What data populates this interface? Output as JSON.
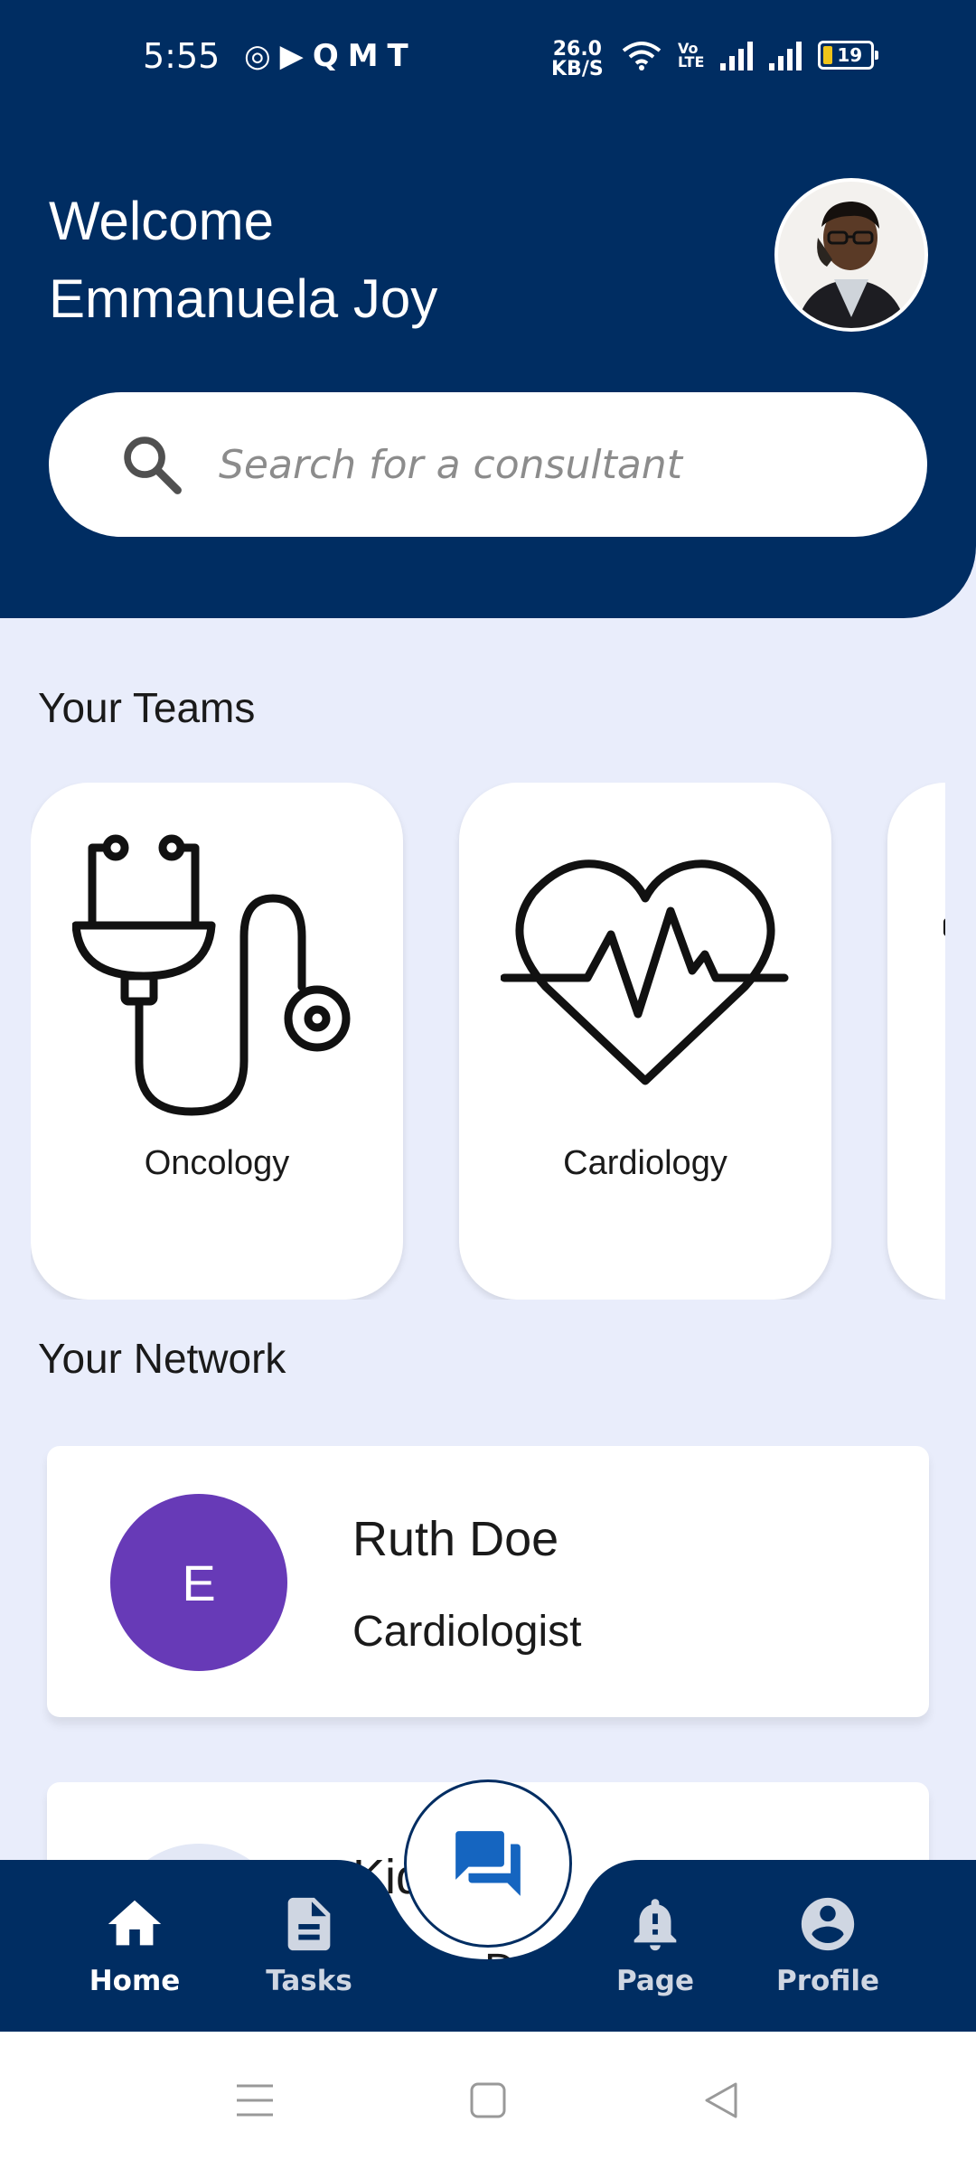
{
  "status_bar": {
    "time": "5:55",
    "app_glyphs": "◎▶QMT",
    "speed_value": "26.0",
    "speed_unit": "KB/S",
    "volte_top": "Vo",
    "volte_bottom": "LTE",
    "battery": "19"
  },
  "header": {
    "greeting": "Welcome",
    "user_name": "Emmanuela Joy",
    "bg_color": "#002d62"
  },
  "search": {
    "placeholder": "Search for a consultant"
  },
  "teams": {
    "title": "Your Teams",
    "items": [
      {
        "label": "Oncology",
        "icon": "stethoscope-icon"
      },
      {
        "label": "Cardiology",
        "icon": "heart-pulse-icon"
      }
    ]
  },
  "network": {
    "title": "Your Network",
    "people": [
      {
        "initial": "E",
        "name": "Ruth Doe",
        "role": "Cardiologist",
        "avatar_color": "#673ab7"
      },
      {
        "initial": "",
        "name": "Kid",
        "role": "Do",
        "avatar_color": "#e3e8f6"
      }
    ]
  },
  "bottom_nav": {
    "items": [
      {
        "label": "Home",
        "icon": "home-icon",
        "active": true
      },
      {
        "label": "Tasks",
        "icon": "document-icon",
        "active": false
      },
      {
        "label": "Page",
        "icon": "bell-icon",
        "active": false
      },
      {
        "label": "Profile",
        "icon": "account-circle-icon",
        "active": false
      }
    ],
    "fab_icon": "chat-icon",
    "accent_color": "#1565c0"
  }
}
